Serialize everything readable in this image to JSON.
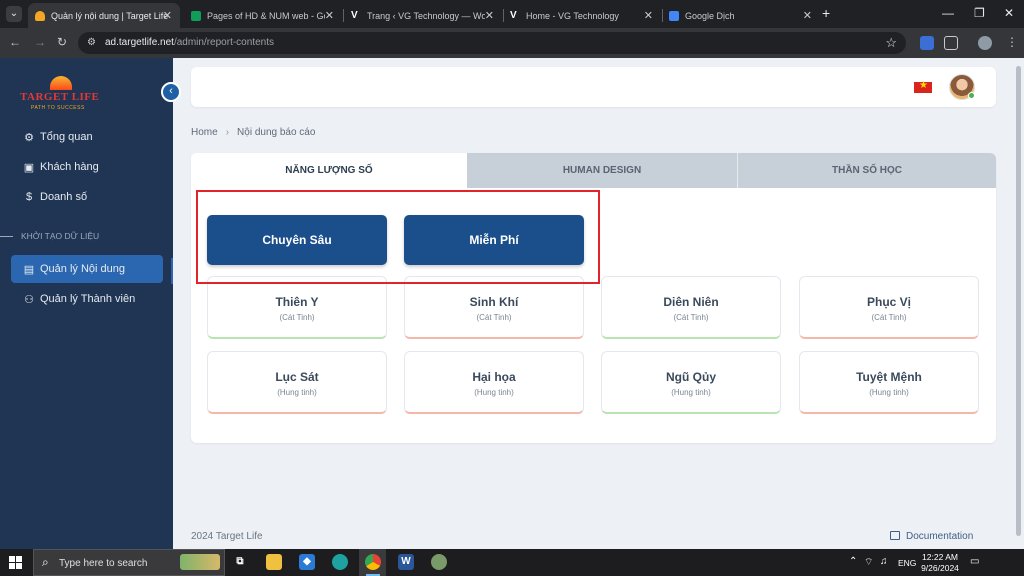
{
  "browser": {
    "tabs": [
      {
        "title": "Quản lý nội dung | Target Life",
        "active": true,
        "favicon_color": "#f5a623"
      },
      {
        "title": "Pages of HD & NUM web - Goo",
        "active": false,
        "favicon_color": "#0f9d58"
      },
      {
        "title": "Trang ‹ VG Technology — Word",
        "active": false,
        "favicon_color": "#ffffff"
      },
      {
        "title": "Home - VG Technology",
        "active": false,
        "favicon_color": "#ffffff"
      },
      {
        "title": "Google Dịch",
        "active": false,
        "favicon_color": "#4285f4"
      }
    ],
    "url_host": "ad.targetlife.net",
    "url_path": "/admin/report-contents"
  },
  "sidebar": {
    "logo_text": "TARGET LIFE",
    "logo_tagline": "PATH TO SUCCESS",
    "items": [
      {
        "label": "Tổng quan",
        "icon": "dashboard-icon"
      },
      {
        "label": "Khách hàng",
        "icon": "contact-card-icon"
      },
      {
        "label": "Doanh số",
        "icon": "dollar-icon"
      }
    ],
    "section_title": "KHỞI TẠO DỮ LIỆU",
    "section_items": [
      {
        "label": "Quản lý Nội dung",
        "icon": "book-icon",
        "active": true
      },
      {
        "label": "Quản lý Thành viên",
        "icon": "users-icon",
        "active": false
      }
    ]
  },
  "breadcrumb": {
    "home": "Home",
    "current": "Nội dung báo cáo"
  },
  "content_tabs": [
    "NĂNG LƯỢNG SỐ",
    "HUMAN DESIGN",
    "THẦN SỐ HỌC"
  ],
  "primary_buttons": [
    "Chuyên Sâu",
    "Miễn Phí"
  ],
  "tiles": [
    {
      "name": "Thiên Y",
      "sub": "(Cát Tinh)",
      "kind": "good"
    },
    {
      "name": "Sinh Khí",
      "sub": "(Cát Tinh)",
      "kind": "good"
    },
    {
      "name": "Diên Niên",
      "sub": "(Cát Tinh)",
      "kind": "good"
    },
    {
      "name": "Phục Vị",
      "sub": "(Cát Tinh)",
      "kind": "good"
    },
    {
      "name": "Lục Sát",
      "sub": "(Hung tinh)",
      "kind": "bad"
    },
    {
      "name": "Hại họa",
      "sub": "(Hung tinh)",
      "kind": "bad"
    },
    {
      "name": "Ngũ Qủy",
      "sub": "(Hung tinh)",
      "kind": "good"
    },
    {
      "name": "Tuyệt Mệnh",
      "sub": "(Hung tinh)",
      "kind": "bad"
    }
  ],
  "footer": {
    "copyright": "2024 Target Life",
    "docs": "Documentation"
  },
  "taskbar": {
    "search_placeholder": "Type here to search",
    "lang": "ENG",
    "time": "12:22 AM",
    "date": "9/26/2024"
  },
  "colors": {
    "sidebar": "#1f3553",
    "accent": "#1b4f8c",
    "highlight": "#e0242a"
  }
}
